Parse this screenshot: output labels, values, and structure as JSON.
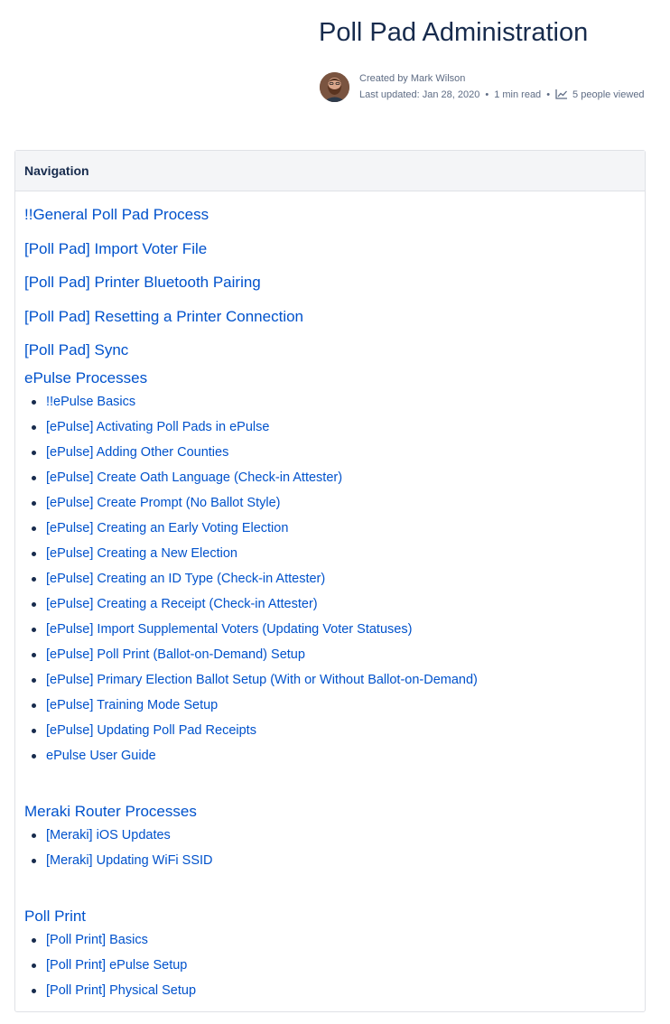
{
  "page": {
    "title": "Poll Pad Administration",
    "created_by": "Created by Mark Wilson",
    "last_updated": "Last updated: Jan 28, 2020",
    "read_time": "1 min read",
    "views": "5 people viewed"
  },
  "panel": {
    "title": "Navigation",
    "top_links": [
      "!!General Poll Pad Process",
      "[Poll Pad] Import Voter File",
      "[Poll Pad] Printer Bluetooth Pairing",
      "[Poll Pad] Resetting a Printer Connection",
      "[Poll Pad] Sync"
    ],
    "sections": [
      {
        "title": "ePulse Processes",
        "items": [
          "!!ePulse Basics",
          "[ePulse] Activating Poll Pads in ePulse",
          "[ePulse] Adding Other Counties",
          "[ePulse] Create Oath Language (Check-in Attester)",
          "[ePulse] Create Prompt (No Ballot Style)",
          "[ePulse] Creating an Early Voting Election",
          "[ePulse] Creating a New Election",
          "[ePulse] Creating an ID Type (Check-in Attester)",
          "[ePulse] Creating a Receipt (Check-in Attester)",
          "[ePulse] Import Supplemental Voters (Updating Voter Statuses)",
          "[ePulse] Poll Print (Ballot-on-Demand) Setup",
          "[ePulse] Primary Election Ballot Setup (With or Without Ballot-on-Demand)",
          "[ePulse] Training Mode Setup",
          "[ePulse] Updating Poll Pad Receipts",
          "ePulse User Guide"
        ]
      },
      {
        "title": "Meraki Router Processes",
        "items": [
          "[Meraki] iOS Updates",
          "[Meraki] Updating WiFi SSID"
        ]
      },
      {
        "title": "Poll Print",
        "items": [
          "[Poll Print] Basics",
          "[Poll Print] ePulse Setup",
          "[Poll Print] Physical Setup"
        ]
      }
    ]
  },
  "icons": {
    "avatar": "avatar",
    "views": "line-chart-icon"
  },
  "colors": {
    "link": "#0052cc",
    "text": "#172b4d",
    "meta": "#5e6c84",
    "header_bg": "#f4f5f7",
    "border": "#dfe1e6"
  }
}
